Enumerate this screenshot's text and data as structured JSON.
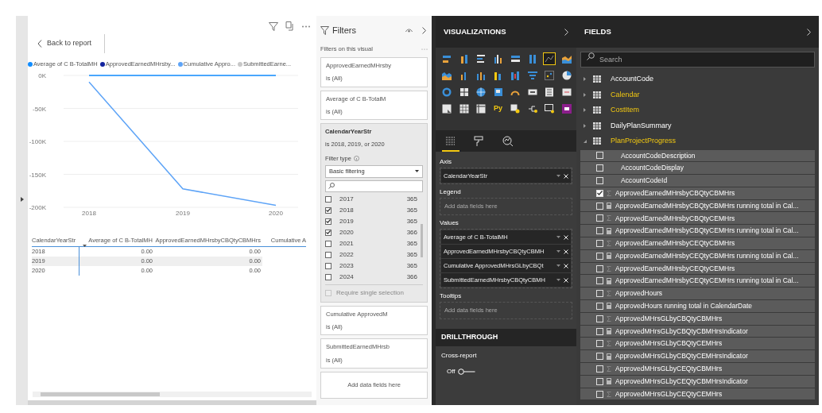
{
  "visual": {
    "back_label": "Back to report",
    "chart_data": {
      "type": "line",
      "grid": true,
      "categories": [
        "2018",
        "2019",
        "2020"
      ],
      "ylim": [
        -200000,
        0
      ],
      "yticks": [
        {
          "value": 0,
          "label": "0K"
        },
        {
          "value": -50000,
          "label": "-50K"
        },
        {
          "value": -100000,
          "label": "-100K"
        },
        {
          "value": -150000,
          "label": "-150K"
        },
        {
          "value": -200000,
          "label": "-200K"
        }
      ],
      "series": [
        {
          "name": "Average of C B-TotalMH",
          "color": "#118dff",
          "values": [
            0,
            0,
            0
          ]
        },
        {
          "name": "ApprovedEarnedMHrsby...",
          "color": "#12239e",
          "values": [
            null,
            null,
            null
          ]
        },
        {
          "name": "Cumulative Appro...",
          "color": "#5ea4f7",
          "values": [
            -10000,
            -172000,
            -197000
          ]
        },
        {
          "name": "SubmittedEarne...",
          "color": "#c8c8c8",
          "values": [
            null,
            null,
            null
          ]
        }
      ]
    },
    "table": {
      "columns": [
        "CalendarYearStr",
        "Average of C B-TotalMH",
        "ApprovedEarnedMHrsbyCBQtyCBMHrs",
        "Cumulative A"
      ],
      "rows": [
        {
          "cells": [
            "2018",
            "0.00",
            "0.00"
          ],
          "selected": false
        },
        {
          "cells": [
            "2019",
            "0.00",
            "0.00"
          ],
          "selected": true
        },
        {
          "cells": [
            "2020",
            "0.00",
            "0.00"
          ],
          "selected": false
        }
      ]
    }
  },
  "filters": {
    "title": "Filters",
    "subtitle": "Filters on this visual",
    "cards": [
      {
        "kind": "collapsed",
        "field": "ApprovedEarnedMHrsby",
        "summary": "is (All)"
      },
      {
        "kind": "collapsed",
        "field": "Average of C B-TotalM",
        "summary": "is (All)"
      },
      {
        "kind": "expanded",
        "field": "CalendarYearStr",
        "summary": "is 2018, 2019, or 2020",
        "filter_type_label": "Filter type",
        "filter_type": "Basic filtering",
        "items": [
          {
            "label": "2017",
            "count": "365",
            "checked": false
          },
          {
            "label": "2018",
            "count": "365",
            "checked": true
          },
          {
            "label": "2019",
            "count": "365",
            "checked": true
          },
          {
            "label": "2020",
            "count": "366",
            "checked": true
          },
          {
            "label": "2021",
            "count": "365",
            "checked": false
          },
          {
            "label": "2022",
            "count": "365",
            "checked": false
          },
          {
            "label": "2023",
            "count": "365",
            "checked": false
          },
          {
            "label": "2024",
            "count": "366",
            "checked": false
          }
        ],
        "require_single": {
          "label": "Require single selection",
          "checked": false,
          "disabled": true
        }
      },
      {
        "kind": "collapsed",
        "field": "Cumulative ApprovedM",
        "summary": "is (All)"
      },
      {
        "kind": "collapsed",
        "field": "SubmittedEarnedMHrsb",
        "summary": "is (All)"
      }
    ],
    "add_placeholder": "Add data fields here"
  },
  "visualizations": {
    "title": "VISUALIZATIONS",
    "visual_types": [
      {
        "kind": "icon",
        "selected": false
      },
      {
        "kind": "icon",
        "selected": false
      },
      {
        "kind": "icon",
        "selected": false
      },
      {
        "kind": "icon",
        "selected": false
      },
      {
        "kind": "icon",
        "selected": false
      },
      {
        "kind": "icon",
        "selected": false
      },
      {
        "kind": "icon",
        "selected": true
      },
      {
        "kind": "icon",
        "selected": false
      },
      {
        "kind": "icon",
        "selected": false
      },
      {
        "kind": "icon",
        "selected": false
      },
      {
        "kind": "icon",
        "selected": false
      },
      {
        "kind": "icon",
        "selected": false
      },
      {
        "kind": "icon",
        "selected": false
      },
      {
        "kind": "icon",
        "selected": false
      },
      {
        "kind": "icon",
        "selected": false
      },
      {
        "kind": "icon",
        "selected": false
      },
      {
        "kind": "icon",
        "selected": false
      },
      {
        "kind": "icon",
        "selected": false
      },
      {
        "kind": "icon",
        "selected": false
      },
      {
        "kind": "icon",
        "selected": false
      },
      {
        "kind": "icon",
        "selected": false
      },
      {
        "kind": "icon",
        "selected": false
      },
      {
        "kind": "icon",
        "selected": false
      },
      {
        "kind": "icon",
        "selected": false
      },
      {
        "kind": "icon",
        "selected": false
      },
      {
        "kind": "icon",
        "selected": false
      },
      {
        "kind": "icon",
        "selected": false
      },
      {
        "kind": "text",
        "label": "Py",
        "selected": false
      },
      {
        "kind": "icon",
        "selected": false
      },
      {
        "kind": "icon",
        "selected": false
      },
      {
        "kind": "icon",
        "selected": false
      },
      {
        "kind": "icon",
        "selected": false
      }
    ],
    "tabs": [
      {
        "selected": true
      },
      {
        "selected": false
      },
      {
        "selected": false
      }
    ],
    "wells": [
      {
        "title": "Axis",
        "fields": [
          "CalendarYearStr"
        ]
      },
      {
        "title": "Legend",
        "placeholder": "Add data fields here"
      },
      {
        "title": "Values",
        "fields": [
          "Average of C B-TotalMH",
          "ApprovedEarnedMHrsbyCBQtyCBMH",
          "Cumulative ApprovedMHrsGLbyCBQt",
          "SubmittedEarnedMHrsbyCBQtyCBMH"
        ]
      },
      {
        "title": "Tooltips",
        "placeholder": "Add data fields here"
      }
    ],
    "drillthrough": {
      "title": "DRILLTHROUGH",
      "label": "Cross-report",
      "toggle_label": "Off",
      "on": false
    }
  },
  "fields": {
    "title": "FIELDS",
    "search_placeholder": "Search",
    "tables": [
      {
        "name": "AccountCode",
        "used": false,
        "expanded": false
      },
      {
        "name": "Calendar",
        "used": true,
        "expanded": false
      },
      {
        "name": "CostItem",
        "used": true,
        "expanded": false
      },
      {
        "name": "DailyPlanSummary",
        "used": false,
        "expanded": false
      },
      {
        "name": "PlanProjectProgress",
        "used": true,
        "expanded": true,
        "children": [
          {
            "name": "AccountCodeDescription",
            "kind": "column",
            "checked": false
          },
          {
            "name": "AccountCodeDisplay",
            "kind": "column",
            "checked": false
          },
          {
            "name": "AccountCodeId",
            "kind": "column",
            "checked": false
          },
          {
            "name": "ApprovedEarnedMHrsbyCBQtyCBMHrs",
            "kind": "sum",
            "checked": true
          },
          {
            "name": "ApprovedEarnedMHrsbyCBQtyCBMHrs running total in Cal...",
            "kind": "measure",
            "checked": false
          },
          {
            "name": "ApprovedEarnedMHrsbyCBQtyCEMHrs",
            "kind": "sum",
            "checked": false
          },
          {
            "name": "ApprovedEarnedMHrsbyCBQtyCEMHrs running total in Cal...",
            "kind": "measure",
            "checked": false
          },
          {
            "name": "ApprovedEarnedMHrsbyCEQtyCBMHrs",
            "kind": "sum",
            "checked": false
          },
          {
            "name": "ApprovedEarnedMHrsbyCEQtyCBMHrs running total in Cal...",
            "kind": "measure",
            "checked": false
          },
          {
            "name": "ApprovedEarnedMHrsbyCEQtyCEMHrs",
            "kind": "sum",
            "checked": false
          },
          {
            "name": "ApprovedEarnedMHrsbyCEQtyCEMHrs running total in Cal...",
            "kind": "measure",
            "checked": false
          },
          {
            "name": "ApprovedHours",
            "kind": "sum",
            "checked": false
          },
          {
            "name": "ApprovedHours running total in CalendarDate",
            "kind": "measure",
            "checked": false
          },
          {
            "name": "ApprovedMHrsGLbyCBQtyCBMHrs",
            "kind": "sum",
            "checked": false
          },
          {
            "name": "ApprovedMHrsGLbyCBQtyCBMHrsIndicator",
            "kind": "measure",
            "checked": false
          },
          {
            "name": "ApprovedMHrsGLbyCBQtyCEMHrs",
            "kind": "sum",
            "checked": false
          },
          {
            "name": "ApprovedMHrsGLbyCBQtyCEMHrsIndicator",
            "kind": "measure",
            "checked": false
          },
          {
            "name": "ApprovedMHrsGLbyCEQtyCBMHrs",
            "kind": "sum",
            "checked": false
          },
          {
            "name": "ApprovedMHrsGLbyCEQtyCBMHrsIndicator",
            "kind": "measure",
            "checked": false
          },
          {
            "name": "ApprovedMHrsGLbyCEQtyCEMHrs",
            "kind": "sum",
            "checked": false
          }
        ]
      }
    ]
  }
}
